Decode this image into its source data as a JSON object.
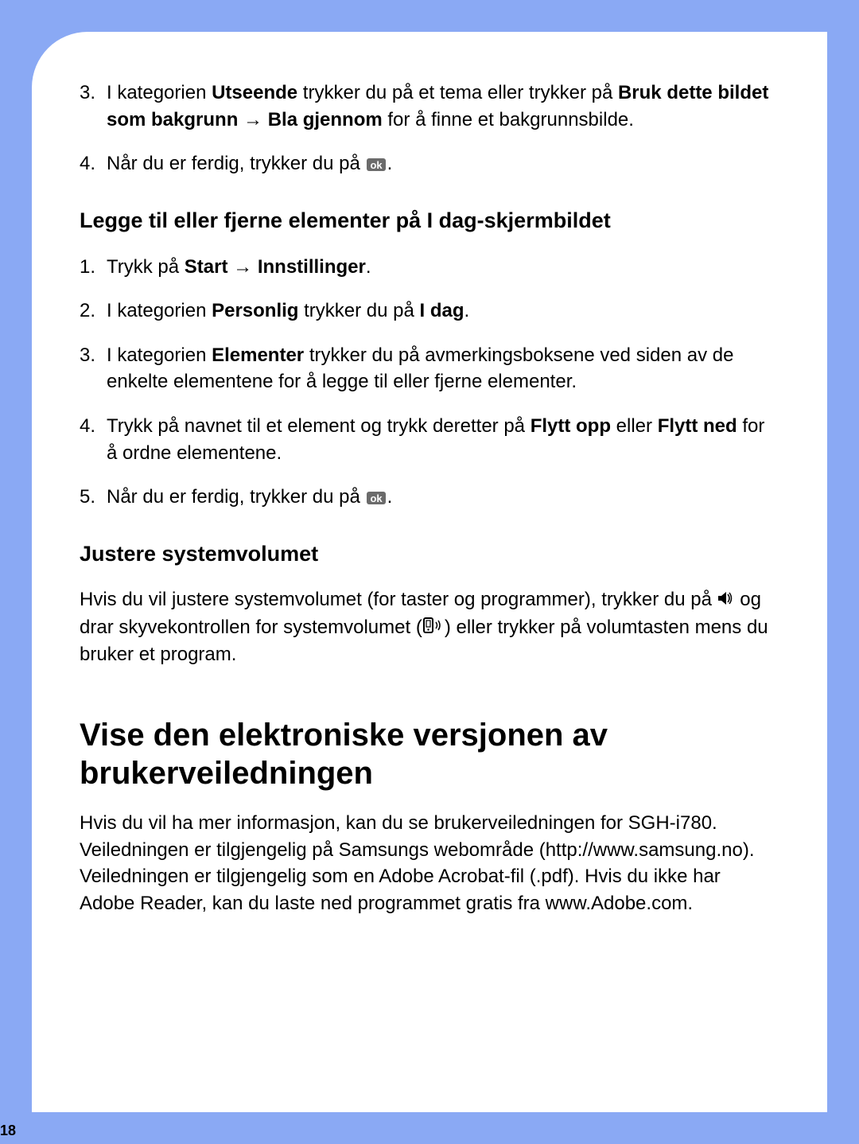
{
  "pageNumber": "18",
  "arrowGlyph": "→",
  "okText": "ok",
  "stepsA": {
    "s3": {
      "num": "3.",
      "t1": "I kategorien ",
      "b1": "Utseende",
      "t2": " trykker du på et tema eller trykker på ",
      "b2": "Bruk dette bildet som bakgrunn",
      "t3": " ",
      "b3": "Bla gjennom",
      "t4": " for å finne et bakgrunnsbilde."
    },
    "s4": {
      "num": "4.",
      "t1": "Når du er ferdig, trykker du på ",
      "t2": "."
    }
  },
  "heading1": "Legge til eller fjerne elementer på I dag-skjermbildet",
  "stepsB": {
    "s1": {
      "num": "1.",
      "t1": "Trykk på ",
      "b1": "Start",
      "t2": " ",
      "b2": "Innstillinger",
      "t3": "."
    },
    "s2": {
      "num": "2.",
      "t1": "I kategorien ",
      "b1": "Personlig",
      "t2": " trykker du på ",
      "b2": "I dag",
      "t3": "."
    },
    "s3": {
      "num": "3.",
      "t1": "I kategorien ",
      "b1": "Elementer",
      "t2": " trykker du på avmerkingsboksene ved siden av de enkelte elementene for å legge til eller fjerne elementer."
    },
    "s4": {
      "num": "4.",
      "t1": "Trykk på navnet til et element og trykk deretter på ",
      "b1": "Flytt opp",
      "t2": " eller ",
      "b2": "Flytt ned",
      "t3": " for å ordne elementene."
    },
    "s5": {
      "num": "5.",
      "t1": "Når du er ferdig, trykker du på ",
      "t2": "."
    }
  },
  "heading2": "Justere systemvolumet",
  "para1": {
    "t1": "Hvis du vil justere systemvolumet (for taster og programmer), trykker du på ",
    "t2": " og drar skyvekontrollen for systemvolumet (",
    "t3": ") eller trykker på volumtasten mens du bruker et program."
  },
  "sectionTitle": "Vise den elektroniske versjonen av brukerveiledningen",
  "para2": "Hvis du vil ha mer informasjon, kan du se brukerveiledningen for SGH-i780. Veiledningen er tilgjengelig på Samsungs webområde (http://www.samsung.no). Veiledningen er tilgjengelig som en Adobe Acrobat-fil (.pdf). Hvis du ikke har Adobe Reader, kan du laste ned programmet gratis fra www.Adobe.com."
}
